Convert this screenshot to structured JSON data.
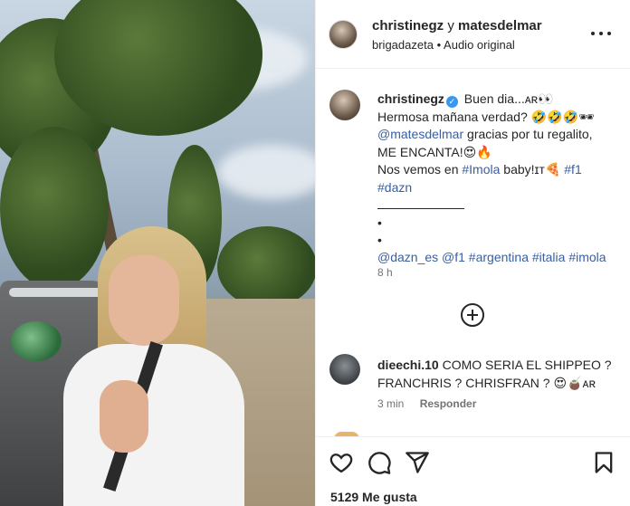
{
  "post": {
    "header": {
      "author1": "christinegz",
      "conjunction": "y",
      "author2": "matesdelmar",
      "subtitle_user": "brigadazeta",
      "subtitle_sep": "•",
      "subtitle_audio": "Audio original"
    },
    "caption": {
      "username": "christinegz",
      "verified_glyph": "✓",
      "line1": "Buen dia...",
      "line1_emoji": "ᴀʀ👀",
      "line2": "Hermosa mañana verdad? 🤣🤣🤣🕶",
      "mention": "@matesdelmar",
      "line3": " gracias por tu regalito,",
      "line4": "ME ENCANTA!😍🔥",
      "line5": "Nos vemos en ",
      "hashtag_imola": "#Imola",
      "line5b": " baby!ɪᴛ🍕 ",
      "hashtag_f1": "#f1",
      "hashtag_dazn": "#dazn",
      "bullet": "•",
      "tags": "@dazn_es @f1 #argentina #italia #imola",
      "time": "8 h"
    },
    "comment": {
      "username": "dieechi.10",
      "text": " COMO SERIA EL SHIPPEO ? FRANCHRIS ? CHRISFRAN ? 😍🧉ᴀʀ",
      "time": "3 min",
      "reply": "Responder"
    },
    "likes": "5129 Me gusta"
  },
  "icons": [
    "more-options-icon",
    "add-comment-icon",
    "heart-icon",
    "comment-icon",
    "share-icon",
    "bookmark-icon"
  ],
  "colors": {
    "link": "#385fa0",
    "verified": "#3897f0",
    "text": "#262626",
    "muted": "#737373"
  }
}
